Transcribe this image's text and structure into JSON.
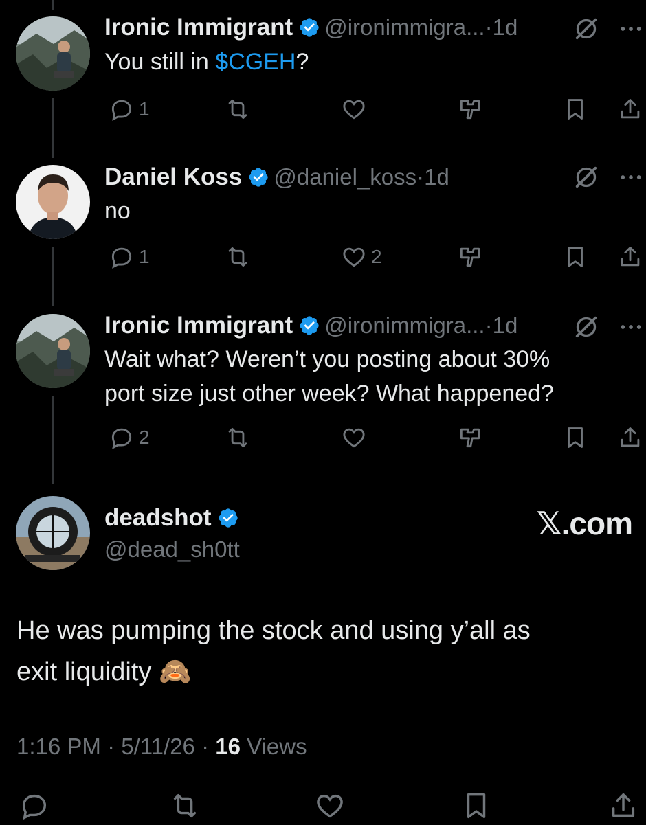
{
  "replies": [
    {
      "name": "Ironic Immigrant",
      "handle": "@ironimmigra...",
      "sep": "·",
      "time": "1d",
      "text_before": "You still in ",
      "cashtag": "$CGEH",
      "text_after": "?",
      "replies_count": "1",
      "likes_count": ""
    },
    {
      "name": "Daniel Koss",
      "handle": "@daniel_koss",
      "sep": "·",
      "time": "1d",
      "text": "no",
      "replies_count": "1",
      "likes_count": "2"
    },
    {
      "name": "Ironic Immigrant",
      "handle": "@ironimmigra...",
      "sep": "·",
      "time": "1d",
      "text_line1": "Wait what? Weren’t you posting about 30%",
      "text_line2": "port size just other week? What happened?",
      "replies_count": "2",
      "likes_count": ""
    }
  ],
  "main_post": {
    "name": "deadshot",
    "handle": "@dead_sh0tt",
    "watermark": "𝕏.com",
    "text_line1": "He was pumping the stock and using y’all as",
    "text_line2": "exit liquidity ",
    "emoji": "🙈",
    "time": "1:16 PM",
    "date": "5/11/26",
    "sep": "·",
    "views_count": "16",
    "views_label": "Views"
  },
  "colors": {
    "background": "#000000",
    "text": "#e7e9ea",
    "muted": "#71767b",
    "accent": "#1d9bf0"
  },
  "icons": [
    "reply-icon",
    "retweet-icon",
    "like-icon",
    "analytics-icon",
    "bookmark-icon",
    "share-icon",
    "grok-icon",
    "more-icon",
    "verified-icon"
  ]
}
